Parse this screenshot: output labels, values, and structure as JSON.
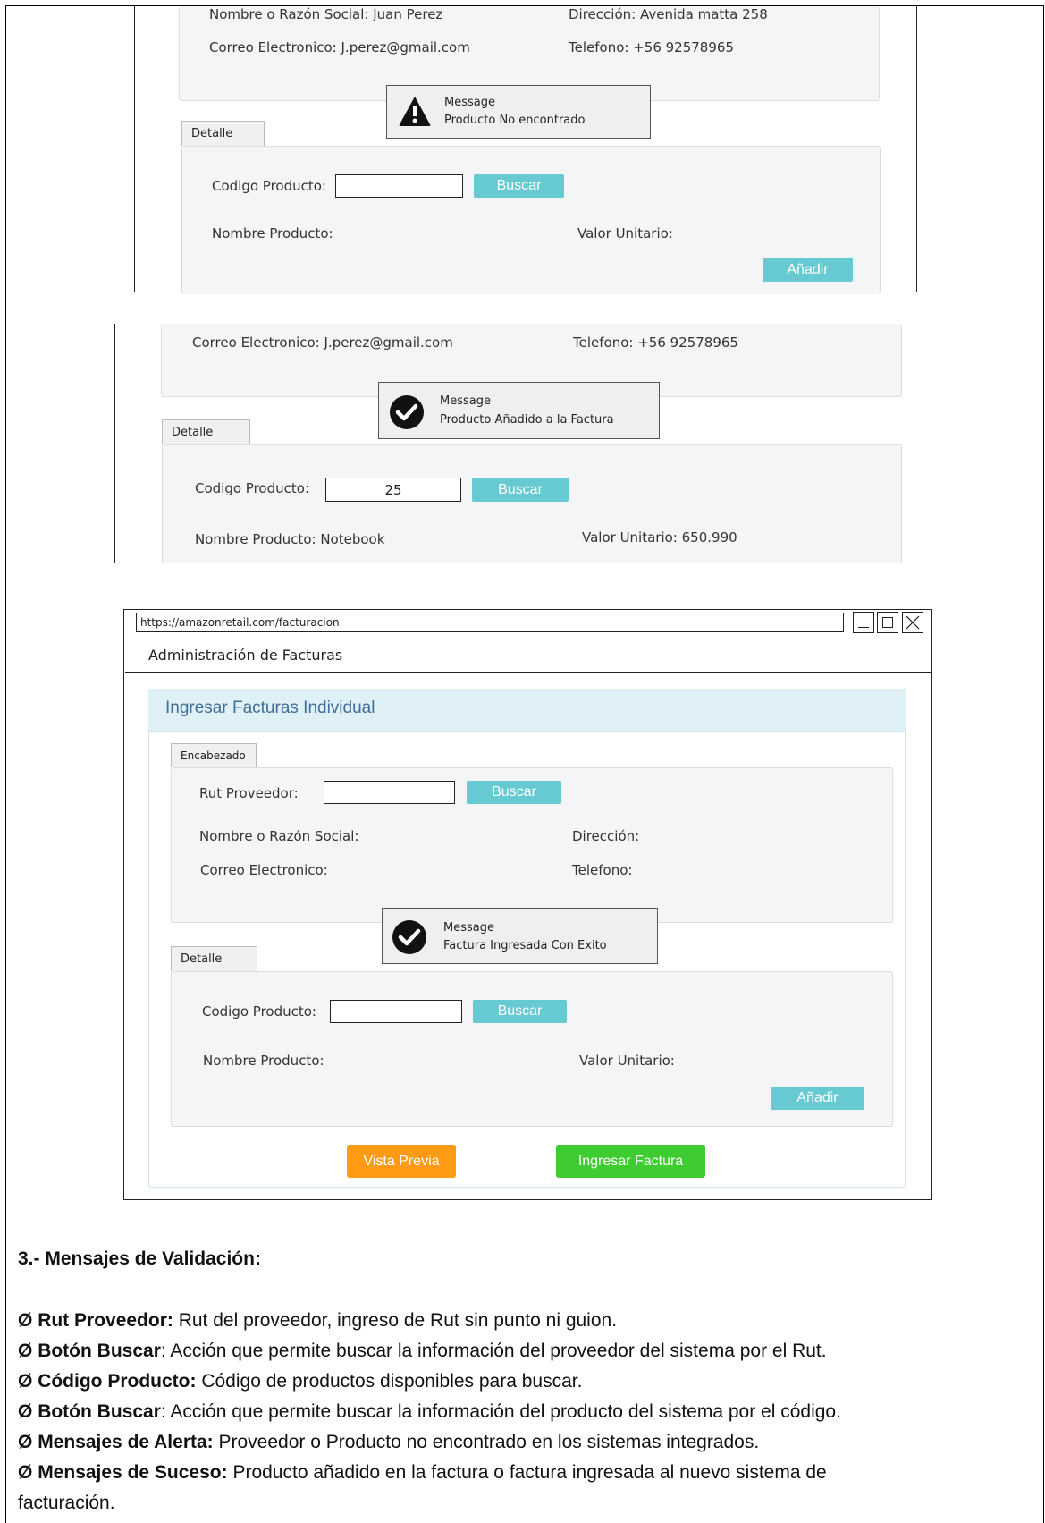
{
  "shot1": {
    "name_label": "Nombre o Razón Social: Juan Perez",
    "address_label": "Dirección: Avenida matta 258",
    "email_label": "Correo Electronico: J.perez@gmail.com",
    "phone_label": "Telefono: +56 92578965",
    "message_title": "Message",
    "message_text": "Producto No encontrado",
    "tab_detalle": "Detalle",
    "codigo_label": "Codigo Producto:",
    "codigo_value": "",
    "buscar_label": "Buscar",
    "nombre_producto_label": "Nombre Producto:",
    "valor_unitario_label": "Valor Unitario:",
    "anadir_label": "Añadir"
  },
  "shot2": {
    "email_label": "Correo Electronico: J.perez@gmail.com",
    "phone_label": "Telefono: +56 92578965",
    "message_title": "Message",
    "message_text": "Producto Añadido a la Factura",
    "tab_detalle": "Detalle",
    "codigo_label": "Codigo Producto:",
    "codigo_value": "25",
    "buscar_label": "Buscar",
    "nombre_producto_label": "Nombre Producto: Notebook",
    "valor_unitario_label": "Valor Unitario: 650.990"
  },
  "shot3": {
    "url": "https://amazonretail.com/facturacion",
    "app_title": "Administración de Facturas",
    "panel_title": "Ingresar Facturas Individual",
    "tab_encabezado": "Encabezado",
    "rut_label": "Rut Proveedor:",
    "rut_value": "",
    "buscar_label": "Buscar",
    "nombre_label": "Nombre o Razón Social:",
    "direccion_label": "Dirección:",
    "correo_label": "Correo Electronico:",
    "telefono_label": "Telefono:",
    "message_title": "Message",
    "message_text": "Factura Ingresada Con Exito",
    "tab_detalle": "Detalle",
    "codigo_label": "Codigo Producto:",
    "codigo_value": "",
    "buscar2_label": "Buscar",
    "nombre_producto_label": "Nombre Producto:",
    "valor_unitario_label": "Valor Unitario:",
    "anadir_label": "Añadir",
    "vista_previa_label": "Vista Previa",
    "ingresar_label": "Ingresar Factura"
  },
  "spec": {
    "heading": "3.- Mensajes de Validación:",
    "bullet": "Ø",
    "items": [
      {
        "term": "Rut Proveedor:",
        "text": " Rut del proveedor, ingreso de Rut sin punto ni guion."
      },
      {
        "term": "Botón Buscar",
        "text": ": Acción que permite buscar la información del proveedor del sistema por el Rut."
      },
      {
        "term": "Código Producto:",
        "text": " Código de productos disponibles para buscar."
      },
      {
        "term": "Botón Buscar",
        "text": ": Acción que permite buscar la información del producto del sistema por el código."
      },
      {
        "term": "Mensajes de Alerta:",
        "text": " Proveedor o Producto no encontrado en los sistemas integrados."
      },
      {
        "term": "Mensajes de Suceso:",
        "text": " Producto añadido en la factura o factura ingresada al nuevo sistema de"
      }
    ],
    "continuation": "facturación."
  },
  "colors": {
    "teal_button": "#67c9d1",
    "orange_button": "#fe9a14",
    "green_button": "#3fcc31",
    "header_panel": "#dff0f7"
  }
}
